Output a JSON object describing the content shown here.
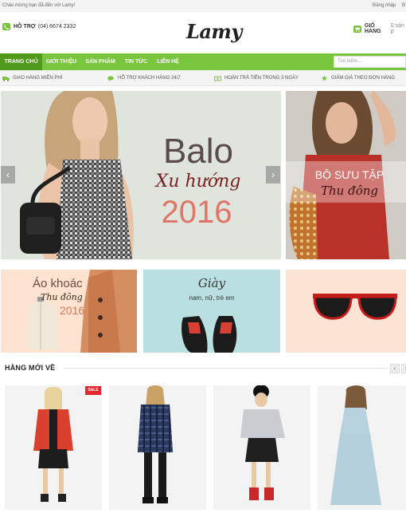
{
  "topbar": {
    "welcome": "Chào mừng bạn đã đến với Lamy!",
    "login": "Đăng nhập",
    "register": "Đ"
  },
  "header": {
    "hotline_label": "HỖ TRỢ",
    "hotline_number": "(04) 6674 2332",
    "logo": "Lamy",
    "cart_label": "GIỎ HÀNG",
    "cart_count": "0 sản p"
  },
  "nav": {
    "items": [
      {
        "label": "TRANG CHỦ"
      },
      {
        "label": "GIỚI THIỆU"
      },
      {
        "label": "SẢN PHẨM"
      },
      {
        "label": "TIN TỨC"
      },
      {
        "label": "LIÊN HỆ"
      }
    ],
    "search_placeholder": "Tìm kiếm..."
  },
  "features": [
    {
      "label": "GIAO HÀNG MIỄN PHÍ",
      "icon": "truck-icon"
    },
    {
      "label": "HỖ TRỢ KHÁCH HÀNG 24/7",
      "icon": "chat-icon"
    },
    {
      "label": "HOÀN TRẢ TIỀN TRONG 3 NGÀY",
      "icon": "money-icon"
    },
    {
      "label": "GIẢM GIÁ THEO ĐƠN HÀNG",
      "icon": "star-icon"
    }
  ],
  "slider": {
    "title": "Balo",
    "subtitle": "Xu hướng",
    "year": "2016",
    "prev": "‹",
    "next": "›"
  },
  "side_banner": {
    "title": "BỘ SƯU TẬP",
    "subtitle": "Thu đông"
  },
  "promos": {
    "coat_title": "Áo khoác",
    "coat_sub": "Thu đông",
    "coat_year": "2016",
    "shoe_title": "Giày",
    "shoe_sub": "nam, nữ, trẻ em"
  },
  "section": {
    "title": "HÀNG MỚI VỀ",
    "prev": "‹",
    "next": "›"
  },
  "products": [
    {
      "badge": "SALE"
    },
    {
      "badge": ""
    },
    {
      "badge": ""
    },
    {
      "badge": ""
    }
  ],
  "colors": {
    "accent": "#79c53d",
    "accent_dark": "#4f9a1c",
    "sale": "#e5262e"
  }
}
